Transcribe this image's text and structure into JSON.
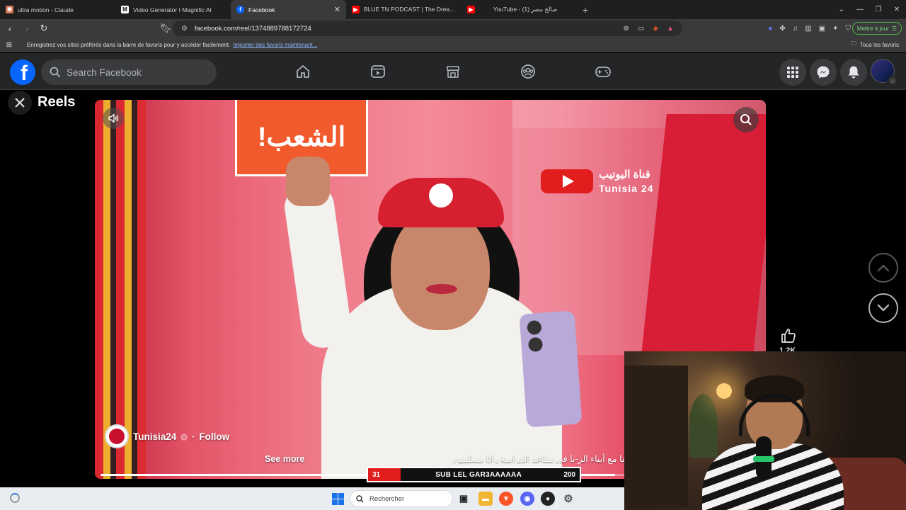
{
  "browser": {
    "tabs": [
      {
        "title": "ultra motion - Claude",
        "favicon": "claude-icon",
        "color": "#d97757",
        "active": false
      },
      {
        "title": "Video Generator I Magnific AI",
        "favicon": "magnific-icon",
        "color": "#ffffff",
        "active": false
      },
      {
        "title": "Facebook",
        "favicon": "facebook-icon",
        "color": "#0866ff",
        "active": true
      },
      {
        "title": "BLUE TN PODCAST | The Dreamer لي",
        "favicon": "youtube-icon",
        "color": "#ff0000",
        "active": false
      },
      {
        "title": "YouTube - صالح مصر (1)",
        "favicon": "youtube-icon",
        "color": "#ff0000",
        "active": false
      }
    ],
    "url": "facebook.com/reel/1374889788172724",
    "update_label": "Mettre à jour",
    "bookmarks_message": "Enregistrez vos sites préférés dans la barre de favoris pour y accéder facilement.",
    "bookmarks_link": "Importer des favoris maintenant...",
    "all_bookmarks": "Tous les favoris"
  },
  "facebook": {
    "search_placeholder": "Search Facebook",
    "page_title": "Reels"
  },
  "reel": {
    "sign_text": "الشعب!",
    "channel_watermark_ar": "قناة اليوتيب",
    "channel_watermark_en": "Tunisia 24",
    "owner_name": "Tunisia24",
    "follow_label": "Follow",
    "caption": "...سيب المهاجرين الأفارقة..لا لجمع أبنائنا مع أبناء الز-نا في مقاعد الدراسة رانا مسلمين",
    "see_more": "See more",
    "progress": 0.78,
    "like_count": "1.2K"
  },
  "overlay": {
    "sub_current": "31",
    "sub_goal": "200",
    "sub_label": "SUB LEL GAR3AAAAAA",
    "sub_progress": 0.155
  },
  "taskbar": {
    "search_placeholder": "Rechercher"
  }
}
